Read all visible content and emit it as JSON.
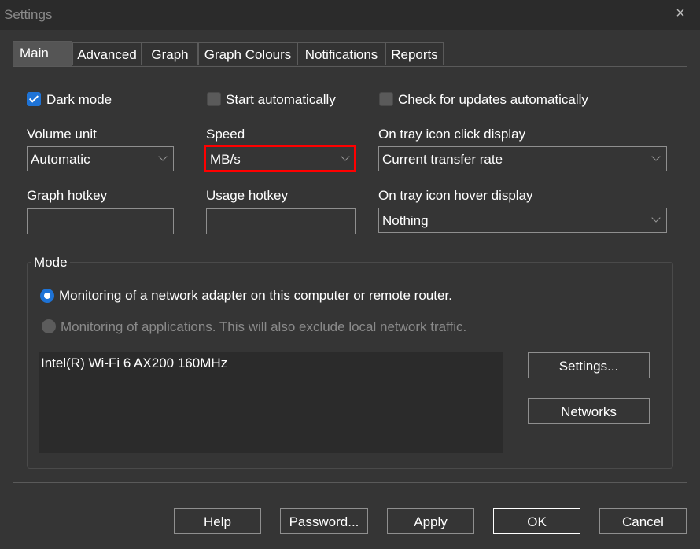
{
  "window": {
    "title": "Settings",
    "close_icon": "×"
  },
  "tabs": [
    {
      "label": "Main",
      "active": true
    },
    {
      "label": "Advanced",
      "active": false
    },
    {
      "label": "Graph",
      "active": false
    },
    {
      "label": "Graph Colours",
      "active": false
    },
    {
      "label": "Notifications",
      "active": false
    },
    {
      "label": "Reports",
      "active": false
    }
  ],
  "main": {
    "checkboxes": {
      "dark_mode": {
        "label": "Dark mode",
        "checked": true
      },
      "start_automatically": {
        "label": "Start automatically",
        "checked": false
      },
      "check_updates": {
        "label": "Check for updates automatically",
        "checked": false
      }
    },
    "volume_unit": {
      "label": "Volume unit",
      "value": "Automatic"
    },
    "speed": {
      "label": "Speed",
      "value": "MB/s",
      "highlight_color": "#ff0000"
    },
    "tray_click": {
      "label": "On tray icon click display",
      "value": "Current transfer rate"
    },
    "graph_hotkey": {
      "label": "Graph hotkey",
      "value": ""
    },
    "usage_hotkey": {
      "label": "Usage hotkey",
      "value": ""
    },
    "tray_hover": {
      "label": "On tray icon hover display",
      "value": "Nothing"
    },
    "mode": {
      "title": "Mode",
      "options": [
        {
          "label": "Monitoring of a network adapter on this computer or remote router.",
          "selected": true,
          "enabled": true
        },
        {
          "label": "Monitoring of applications. This will also exclude local network traffic.",
          "selected": false,
          "enabled": false
        }
      ],
      "adapters": [
        "Intel(R) Wi-Fi 6 AX200 160MHz"
      ],
      "settings_button": "Settings...",
      "networks_button": "Networks"
    }
  },
  "footer": {
    "help": "Help",
    "password": "Password...",
    "apply": "Apply",
    "ok": "OK",
    "cancel": "Cancel"
  },
  "colors": {
    "accent": "#1e73d6",
    "background": "#353535",
    "titlebar": "#2b2b2b"
  }
}
